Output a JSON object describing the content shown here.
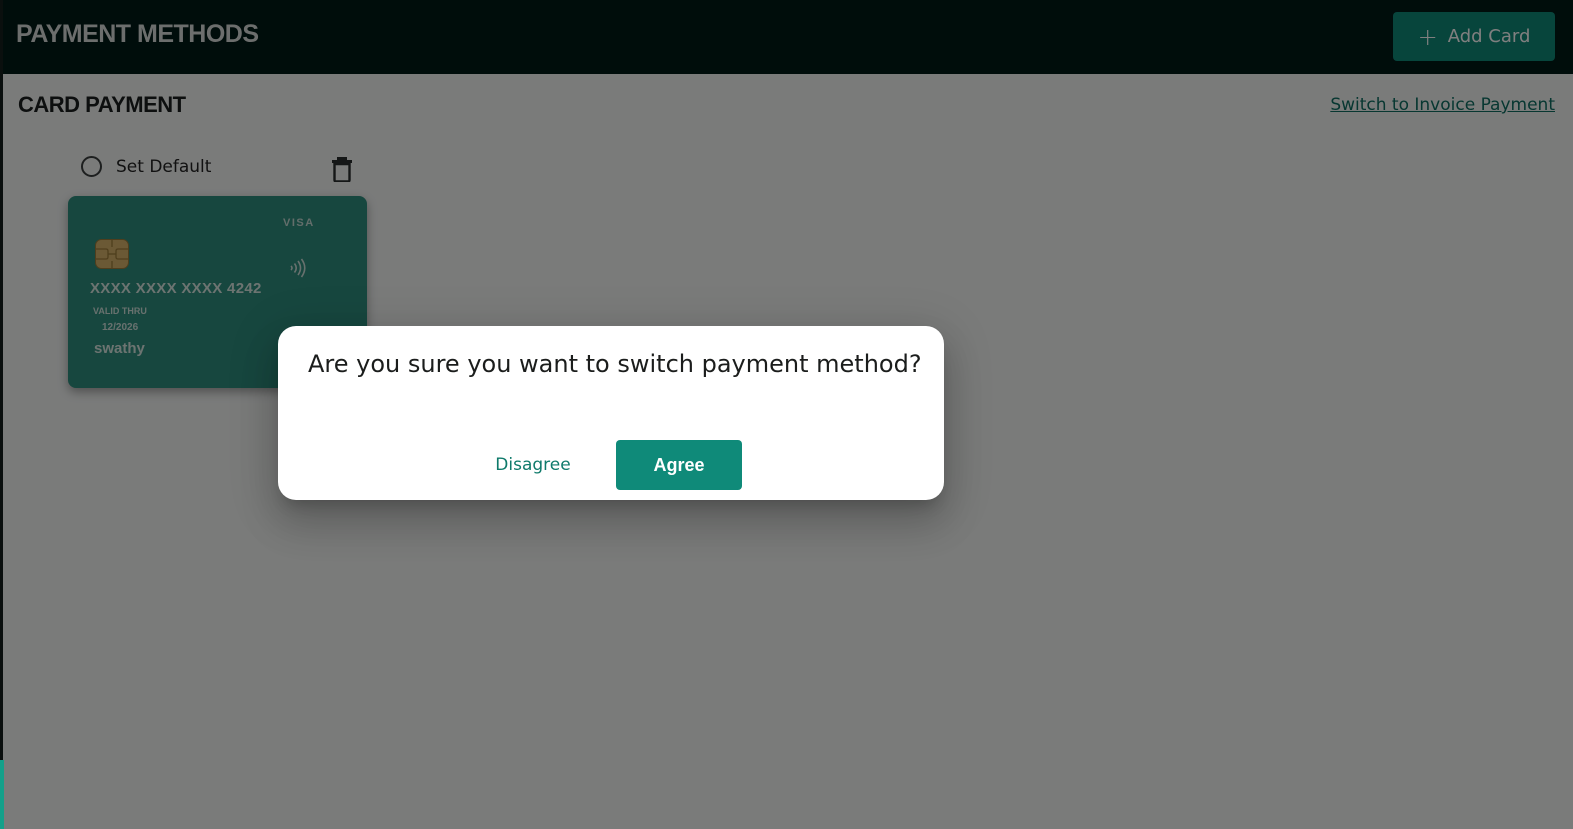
{
  "header": {
    "title": "PAYMENT METHODS",
    "add_card_label": "Add Card",
    "add_card_icon": "plus-icon"
  },
  "section": {
    "title": "CARD PAYMENT",
    "switch_link": "Switch to Invoice Payment"
  },
  "card_controls": {
    "set_default_label": "Set Default",
    "set_default_checked": false,
    "delete_icon": "trash-icon"
  },
  "card": {
    "brand": "VISA",
    "number": "XXXX XXXX XXXX 4242",
    "valid_thru_label": "VALID THRU",
    "expiry": "12/2026",
    "holder": "swathy",
    "chip_icon": "chip-icon",
    "contactless_icon": "contactless-icon"
  },
  "dialog": {
    "message": "Are you sure you want to switch payment method?",
    "disagree_label": "Disagree",
    "agree_label": "Agree"
  },
  "colors": {
    "header_bg": "#011a17",
    "accent": "#0f8a79",
    "card_bg": "#2f8e7f",
    "link": "#0f6f62"
  }
}
